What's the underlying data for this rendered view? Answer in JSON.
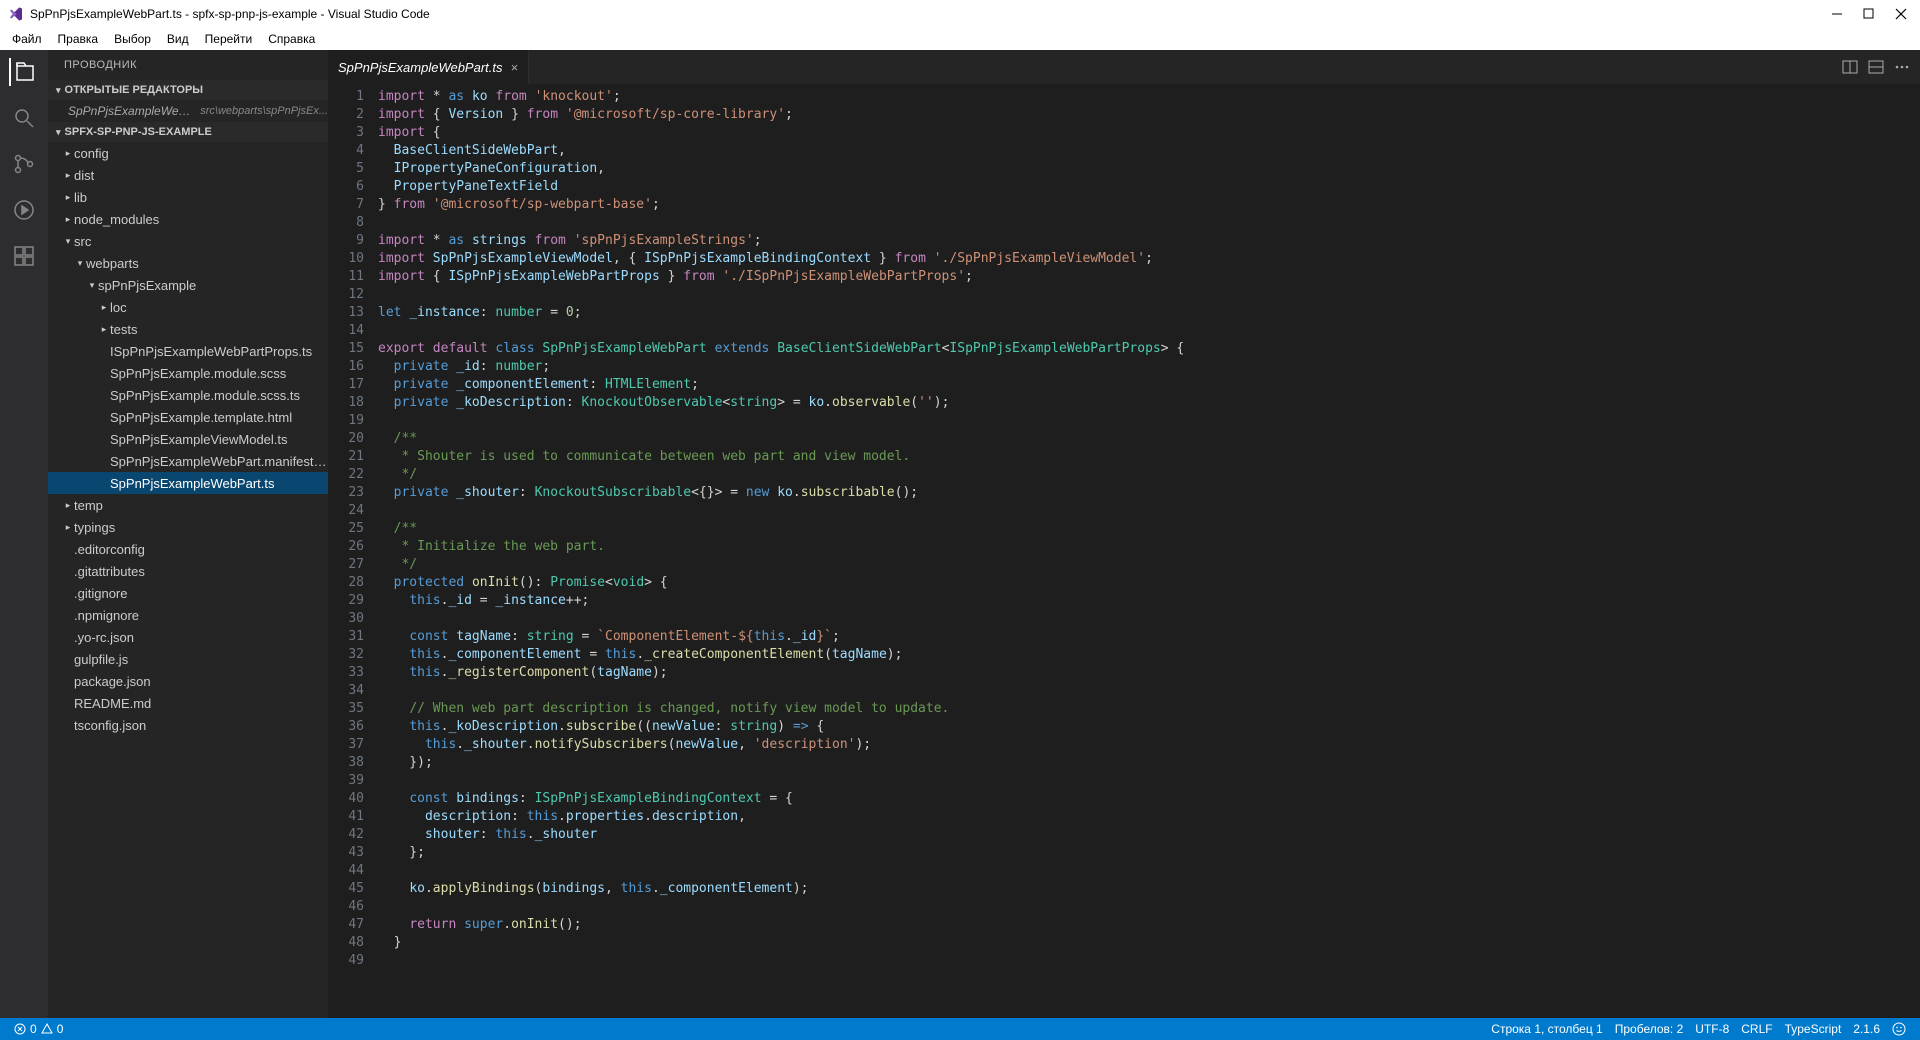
{
  "title": "SpPnPjsExampleWebPart.ts - spfx-sp-pnp-js-example - Visual Studio Code",
  "menu": [
    "Файл",
    "Правка",
    "Выбор",
    "Вид",
    "Перейти",
    "Справка"
  ],
  "explorer_title": "ПРОВОДНИК",
  "open_editors_label": "ОТКРЫТЫЕ РЕДАКТОРЫ",
  "open_editor_file": "SpPnPjsExampleWebPart.ts",
  "open_editor_path": "src\\webparts\\spPnPjsEx...",
  "project_label": "SPFX-SP-PNP-JS-EXAMPLE",
  "tree": {
    "config": "config",
    "dist": "dist",
    "lib": "lib",
    "node_modules": "node_modules",
    "src": "src",
    "webparts": "webparts",
    "spPnPjsExample": "spPnPjsExample",
    "loc": "loc",
    "tests": "tests",
    "f1": "ISpPnPjsExampleWebPartProps.ts",
    "f2": "SpPnPjsExample.module.scss",
    "f3": "SpPnPjsExample.module.scss.ts",
    "f4": "SpPnPjsExample.template.html",
    "f5": "SpPnPjsExampleViewModel.ts",
    "f6": "SpPnPjsExampleWebPart.manifest.json",
    "f7": "SpPnPjsExampleWebPart.ts",
    "temp": "temp",
    "typings": "typings",
    "editorconfig": ".editorconfig",
    "gitattributes": ".gitattributes",
    "gitignore": ".gitignore",
    "npmignore": ".npmignore",
    "yorc": ".yo-rc.json",
    "gulpfile": "gulpfile.js",
    "package": "package.json",
    "readme": "README.md",
    "tsconfig": "tsconfig.json"
  },
  "tab_name": "SpPnPjsExampleWebPart.ts",
  "status": {
    "errors": "0",
    "warnings": "0",
    "cursor": "Строка 1, столбец 1",
    "spaces": "Пробелов: 2",
    "encoding": "UTF-8",
    "eol": "CRLF",
    "lang": "TypeScript",
    "ver": "2.1.6"
  },
  "code": [
    {
      "n": 1,
      "h": "<span class='tk-kw2'>import</span> * <span class='tk-kw'>as</span> <span class='tk-var'>ko</span> <span class='tk-kw2'>from</span> <span class='tk-str'>'knockout'</span>;"
    },
    {
      "n": 2,
      "h": "<span class='tk-kw2'>import</span> { <span class='tk-var'>Version</span> } <span class='tk-kw2'>from</span> <span class='tk-str'>'@microsoft/sp-core-library'</span>;"
    },
    {
      "n": 3,
      "h": "<span class='tk-kw2'>import</span> {"
    },
    {
      "n": 4,
      "h": "  <span class='tk-var'>BaseClientSideWebPart</span>,"
    },
    {
      "n": 5,
      "h": "  <span class='tk-var'>IPropertyPaneConfiguration</span>,"
    },
    {
      "n": 6,
      "h": "  <span class='tk-var'>PropertyPaneTextField</span>"
    },
    {
      "n": 7,
      "h": "} <span class='tk-kw2'>from</span> <span class='tk-str'>'@microsoft/sp-webpart-base'</span>;"
    },
    {
      "n": 8,
      "h": ""
    },
    {
      "n": 9,
      "h": "<span class='tk-kw2'>import</span> * <span class='tk-kw'>as</span> <span class='tk-var'>strings</span> <span class='tk-kw2'>from</span> <span class='tk-str'>'spPnPjsExampleStrings'</span>;"
    },
    {
      "n": 10,
      "h": "<span class='tk-kw2'>import</span> <span class='tk-var'>SpPnPjsExampleViewModel</span>, { <span class='tk-var'>ISpPnPjsExampleBindingContext</span> } <span class='tk-kw2'>from</span> <span class='tk-str'>'./SpPnPjsExampleViewModel'</span>;"
    },
    {
      "n": 11,
      "h": "<span class='tk-kw2'>import</span> { <span class='tk-var'>ISpPnPjsExampleWebPartProps</span> } <span class='tk-kw2'>from</span> <span class='tk-str'>'./ISpPnPjsExampleWebPartProps'</span>;"
    },
    {
      "n": 12,
      "h": ""
    },
    {
      "n": 13,
      "h": "<span class='tk-kw'>let</span> <span class='tk-var'>_instance</span>: <span class='tk-type'>number</span> = <span class='tk-num'>0</span>;"
    },
    {
      "n": 14,
      "h": ""
    },
    {
      "n": 15,
      "h": "<span class='tk-kw2'>export</span> <span class='tk-kw2'>default</span> <span class='tk-kw'>class</span> <span class='tk-type'>SpPnPjsExampleWebPart</span> <span class='tk-kw'>extends</span> <span class='tk-type'>BaseClientSideWebPart</span>&lt;<span class='tk-type'>ISpPnPjsExampleWebPartProps</span>&gt; {"
    },
    {
      "n": 16,
      "h": "  <span class='tk-kw'>private</span> <span class='tk-var'>_id</span>: <span class='tk-type'>number</span>;"
    },
    {
      "n": 17,
      "h": "  <span class='tk-kw'>private</span> <span class='tk-var'>_componentElement</span>: <span class='tk-type'>HTMLElement</span>;"
    },
    {
      "n": 18,
      "h": "  <span class='tk-kw'>private</span> <span class='tk-var'>_koDescription</span>: <span class='tk-type'>KnockoutObservable</span>&lt;<span class='tk-type'>string</span>&gt; = <span class='tk-var'>ko</span>.<span class='tk-fn'>observable</span>(<span class='tk-str'>''</span>);"
    },
    {
      "n": 19,
      "h": ""
    },
    {
      "n": 20,
      "h": "  <span class='tk-cm'>/**</span>"
    },
    {
      "n": 21,
      "h": "<span class='tk-cm'>   * Shouter is used to communicate between web part and view model.</span>"
    },
    {
      "n": 22,
      "h": "<span class='tk-cm'>   */</span>"
    },
    {
      "n": 23,
      "h": "  <span class='tk-kw'>private</span> <span class='tk-var'>_shouter</span>: <span class='tk-type'>KnockoutSubscribable</span>&lt;{}&gt; = <span class='tk-kw'>new</span> <span class='tk-var'>ko</span>.<span class='tk-fn'>subscribable</span>();"
    },
    {
      "n": 24,
      "h": ""
    },
    {
      "n": 25,
      "h": "  <span class='tk-cm'>/**</span>"
    },
    {
      "n": 26,
      "h": "<span class='tk-cm'>   * Initialize the web part.</span>"
    },
    {
      "n": 27,
      "h": "<span class='tk-cm'>   */</span>"
    },
    {
      "n": 28,
      "h": "  <span class='tk-kw'>protected</span> <span class='tk-fn'>onInit</span>(): <span class='tk-type'>Promise</span>&lt;<span class='tk-type'>void</span>&gt; {"
    },
    {
      "n": 29,
      "h": "    <span class='tk-kw'>this</span>.<span class='tk-var'>_id</span> = <span class='tk-var'>_instance</span>++;"
    },
    {
      "n": 30,
      "h": ""
    },
    {
      "n": 31,
      "h": "    <span class='tk-kw'>const</span> <span class='tk-var'>tagName</span>: <span class='tk-type'>string</span> = <span class='tk-str'>`ComponentElement-${</span><span class='tk-kw'>this</span>.<span class='tk-var'>_id</span><span class='tk-str'>}`</span>;"
    },
    {
      "n": 32,
      "h": "    <span class='tk-kw'>this</span>.<span class='tk-var'>_componentElement</span> = <span class='tk-kw'>this</span>.<span class='tk-fn'>_createComponentElement</span>(<span class='tk-var'>tagName</span>);"
    },
    {
      "n": 33,
      "h": "    <span class='tk-kw'>this</span>.<span class='tk-fn'>_registerComponent</span>(<span class='tk-var'>tagName</span>);"
    },
    {
      "n": 34,
      "h": ""
    },
    {
      "n": 35,
      "h": "    <span class='tk-cm'>// When web part description is changed, notify view model to update.</span>"
    },
    {
      "n": 36,
      "h": "    <span class='tk-kw'>this</span>.<span class='tk-var'>_koDescription</span>.<span class='tk-fn'>subscribe</span>((<span class='tk-var'>newValue</span>: <span class='tk-type'>string</span>) <span class='tk-kw'>=&gt;</span> {"
    },
    {
      "n": 37,
      "h": "      <span class='tk-kw'>this</span>.<span class='tk-var'>_shouter</span>.<span class='tk-fn'>notifySubscribers</span>(<span class='tk-var'>newValue</span>, <span class='tk-str'>'description'</span>);"
    },
    {
      "n": 38,
      "h": "    });"
    },
    {
      "n": 39,
      "h": ""
    },
    {
      "n": 40,
      "h": "    <span class='tk-kw'>const</span> <span class='tk-var'>bindings</span>: <span class='tk-type'>ISpPnPjsExampleBindingContext</span> = {"
    },
    {
      "n": 41,
      "h": "      <span class='tk-var'>description</span>: <span class='tk-kw'>this</span>.<span class='tk-var'>properties</span>.<span class='tk-var'>description</span>,"
    },
    {
      "n": 42,
      "h": "      <span class='tk-var'>shouter</span>: <span class='tk-kw'>this</span>.<span class='tk-var'>_shouter</span>"
    },
    {
      "n": 43,
      "h": "    };"
    },
    {
      "n": 44,
      "h": ""
    },
    {
      "n": 45,
      "h": "    <span class='tk-var'>ko</span>.<span class='tk-fn'>applyBindings</span>(<span class='tk-var'>bindings</span>, <span class='tk-kw'>this</span>.<span class='tk-var'>_componentElement</span>);"
    },
    {
      "n": 46,
      "h": ""
    },
    {
      "n": 47,
      "h": "    <span class='tk-kw2'>return</span> <span class='tk-kw'>super</span>.<span class='tk-fn'>onInit</span>();"
    },
    {
      "n": 48,
      "h": "  }"
    },
    {
      "n": 49,
      "h": ""
    }
  ]
}
